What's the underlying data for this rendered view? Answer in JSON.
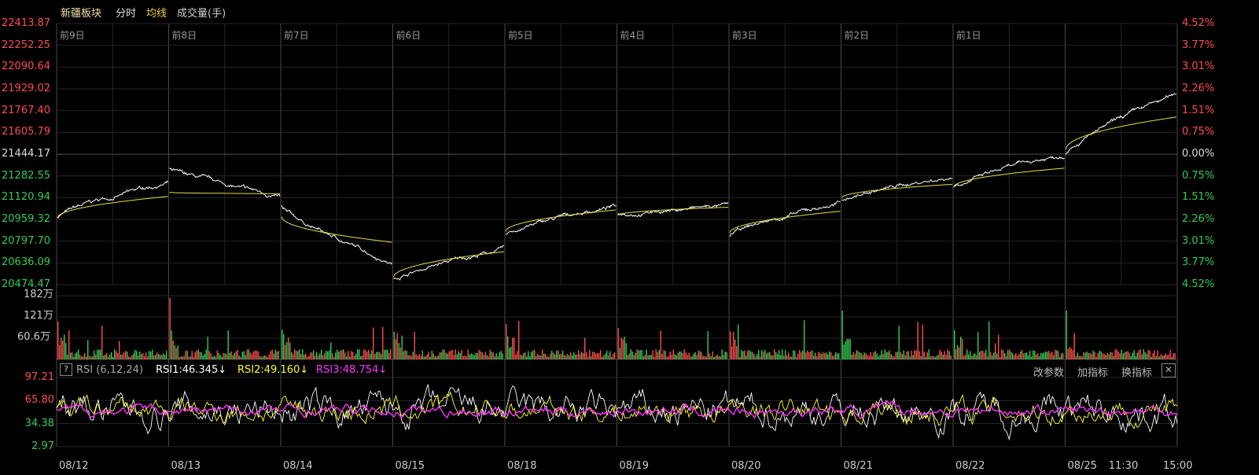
{
  "header": {
    "title": "新疆板块",
    "tab_intraday": "分时",
    "tab_avg": "均线",
    "tab_volume": "成交量(手)"
  },
  "price_axis_left": [
    "22413.87",
    "22252.25",
    "22090.64",
    "21929.02",
    "21767.40",
    "21605.79",
    "21444.17",
    "21282.55",
    "21120.94",
    "20959.32",
    "20797.70",
    "20636.09",
    "20474.47"
  ],
  "price_axis_right": [
    "4.52%",
    "3.77%",
    "3.01%",
    "2.26%",
    "1.51%",
    "0.75%",
    "0.00%",
    "0.75%",
    "1.51%",
    "2.26%",
    "3.01%",
    "3.77%",
    "4.52%"
  ],
  "day_labels": [
    "前9日",
    "前8日",
    "前7日",
    "前6日",
    "前5日",
    "前4日",
    "前3日",
    "前2日",
    "前1日"
  ],
  "volume_axis": [
    "182万",
    "121万",
    "60.6万"
  ],
  "rsi": {
    "help": "?",
    "title": "RSI (6,12,24)",
    "rsi1": "RSI1:46.345↓",
    "rsi2": "RSI2:49.160↓",
    "rsi3": "RSI3:48.754↓",
    "btn_params": "改参数",
    "btn_add": "加指标",
    "btn_switch": "换指标",
    "btn_close": "✕",
    "axis": [
      "97.21",
      "65.80",
      "34.38",
      "2.97"
    ]
  },
  "x_axis": [
    "08/12",
    "08/13",
    "08/14",
    "08/15",
    "08/18",
    "08/19",
    "08/20",
    "08/21",
    "08/22",
    "08/25",
    "11:30",
    "15:00"
  ],
  "colors": {
    "up": "#ff4d4d",
    "down": "#33cc55",
    "price_line": "#ffffff",
    "avg_line": "#e8e04a",
    "rsi1": "#ffffff",
    "rsi2": "#ffff33",
    "rsi3": "#ff33ff",
    "grid": "#3a3a3a"
  },
  "chart_data": {
    "type": "line",
    "series": [
      {
        "name": "price",
        "values": [
          20974,
          21280,
          21210,
          21050,
          20600,
          20560,
          20980,
          21060,
          20950,
          21180,
          21440,
          21820
        ]
      },
      {
        "name": "avg",
        "values": [
          20970,
          21140,
          21160,
          20980,
          20620,
          20720,
          20990,
          21020,
          20990,
          21140,
          21330,
          21700
        ]
      }
    ]
  }
}
